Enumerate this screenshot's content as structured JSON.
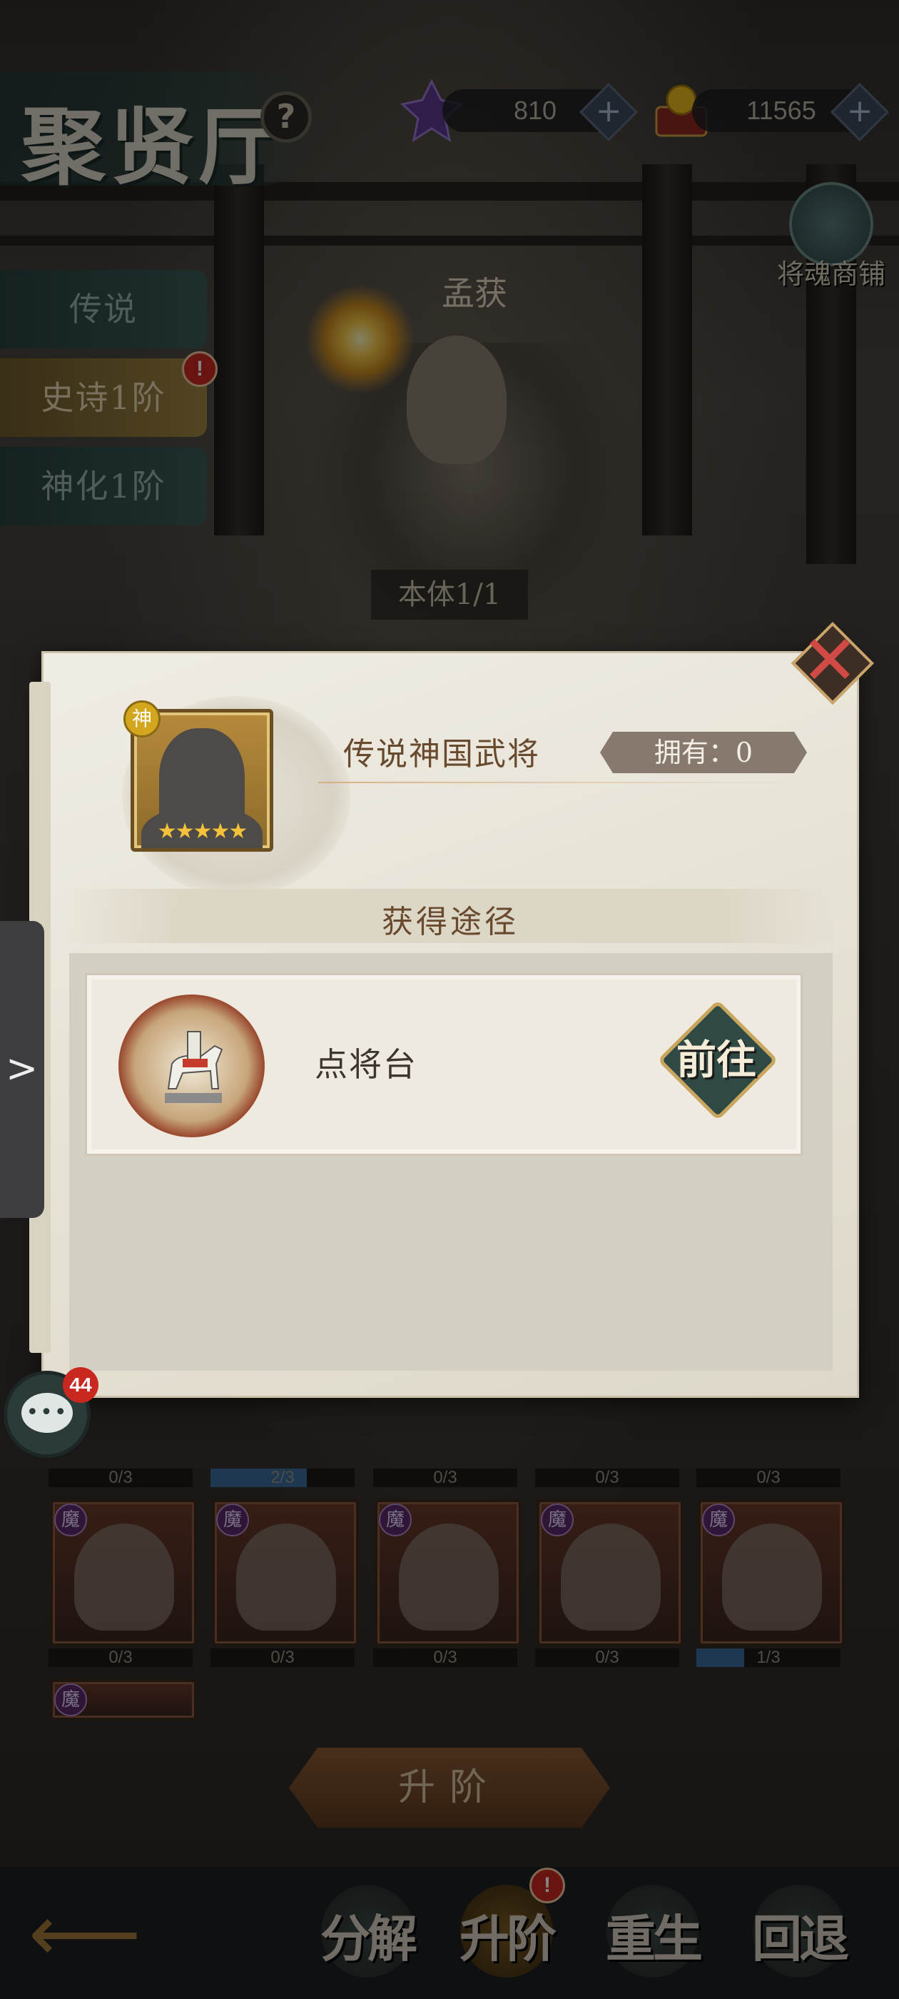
{
  "header": {
    "title": "聚贤厅",
    "help_label": "?",
    "gems": "810",
    "gold": "11565",
    "plus": "+"
  },
  "shop": {
    "label": "将魂商铺"
  },
  "tabs": [
    {
      "label": "传说"
    },
    {
      "label": "史诗1阶",
      "badge": "!"
    },
    {
      "label": "神化1阶"
    }
  ],
  "hero": {
    "name": "孟获",
    "body_label": "本体1/1"
  },
  "modal": {
    "close": "✕",
    "badge": "神",
    "stars": "★★★★★",
    "item_name": "传说神国武将",
    "owned": "拥有：0",
    "section_title": "获得途径",
    "source_name": "点将台",
    "go_label": "前往"
  },
  "grid": {
    "badge": "魔",
    "row1": [
      {
        "progress": "0/3",
        "fill": 0
      },
      {
        "progress": "2/3",
        "fill": 0.667
      },
      {
        "progress": "0/3",
        "fill": 0
      },
      {
        "progress": "0/3",
        "fill": 0
      },
      {
        "progress": "0/3",
        "fill": 0
      }
    ],
    "row2": [
      {
        "progress": "0/3",
        "fill": 0
      },
      {
        "progress": "0/3",
        "fill": 0
      },
      {
        "progress": "0/3",
        "fill": 0
      },
      {
        "progress": "0/3",
        "fill": 0
      },
      {
        "progress": "1/3",
        "fill": 0.333
      }
    ]
  },
  "upgrade_button": "升阶",
  "bottom_actions": [
    {
      "label": "分解"
    },
    {
      "label": "升阶",
      "badge": "!"
    },
    {
      "label": "重生"
    },
    {
      "label": "回退"
    }
  ],
  "chat": {
    "count": "44"
  },
  "side_handle": ">",
  "back": "⟵"
}
